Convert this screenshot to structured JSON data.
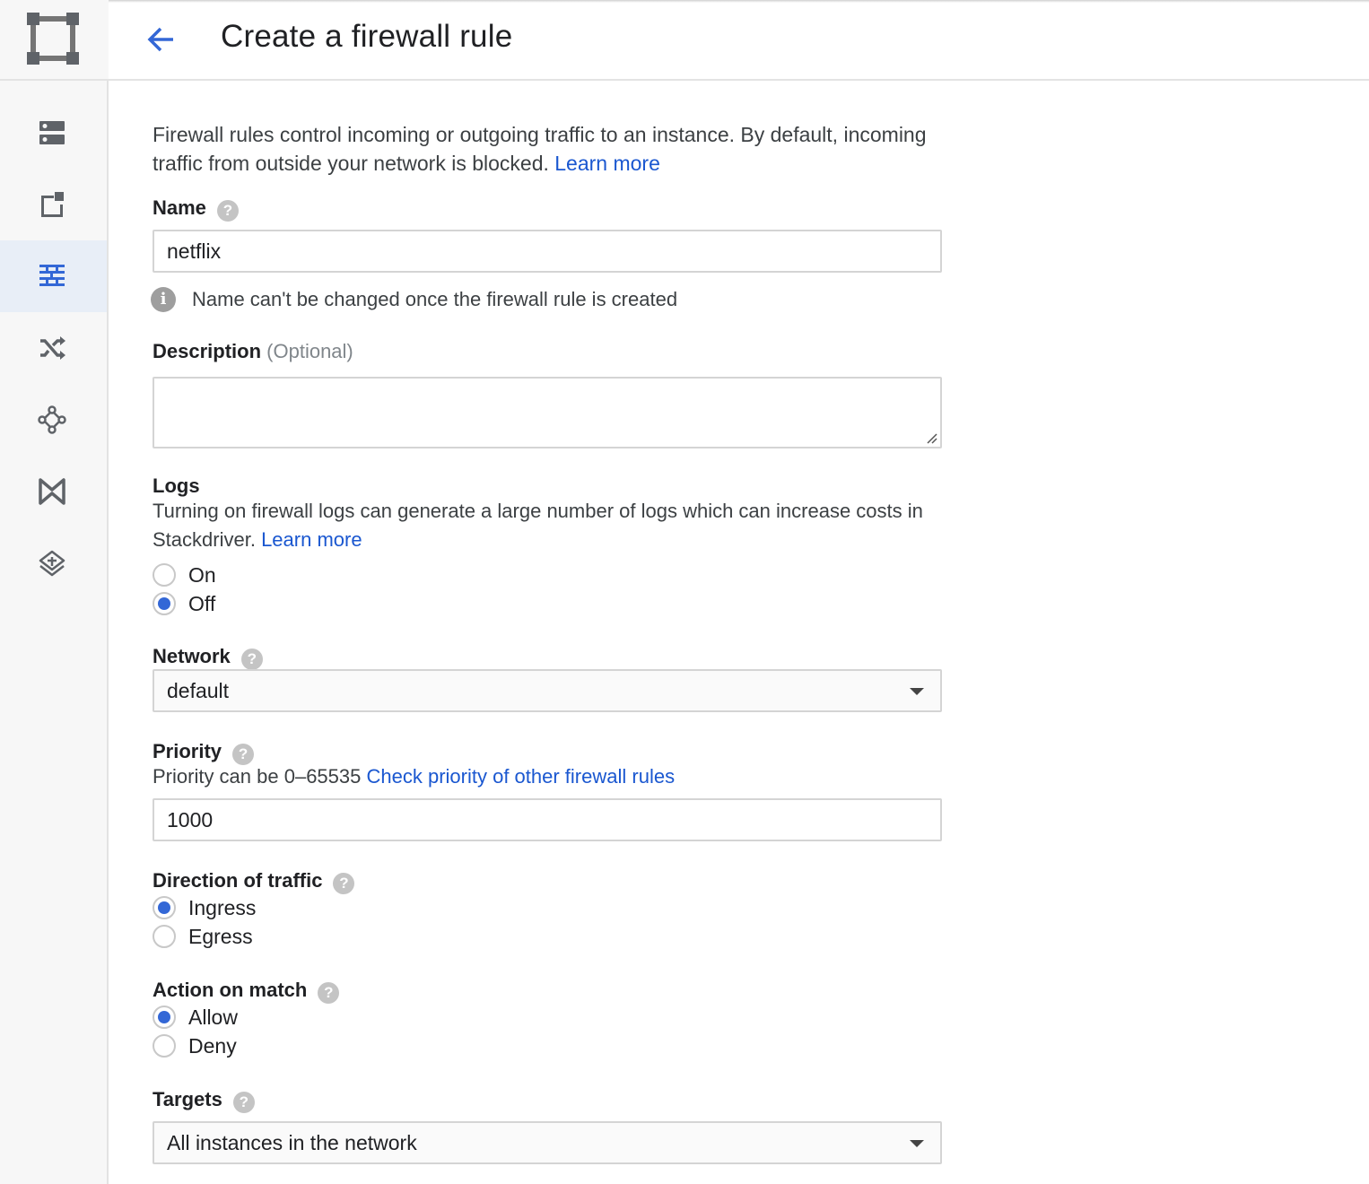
{
  "header": {
    "title": "Create a firewall rule"
  },
  "sidebar": {
    "items": [
      {
        "icon": "instances-icon"
      },
      {
        "icon": "external-ip-icon"
      },
      {
        "icon": "firewall-icon",
        "active": true
      },
      {
        "icon": "routes-icon"
      },
      {
        "icon": "vpc-peering-icon"
      },
      {
        "icon": "shared-vpc-icon"
      },
      {
        "icon": "serverless-vpc-icon"
      }
    ]
  },
  "intro": {
    "text": "Firewall rules control incoming or outgoing traffic to an instance. By default, incoming traffic from outside your network is blocked.",
    "link": "Learn more"
  },
  "name": {
    "label": "Name",
    "value": "netflix",
    "info": "Name can't be changed once the firewall rule is created"
  },
  "description": {
    "label": "Description",
    "optional": "(Optional)",
    "value": ""
  },
  "logs": {
    "label": "Logs",
    "text": "Turning on firewall logs can generate a large number of logs which can increase costs in Stackdriver.",
    "link": "Learn more",
    "options": [
      {
        "label": "On",
        "checked": false
      },
      {
        "label": "Off",
        "checked": true
      }
    ]
  },
  "network": {
    "label": "Network",
    "value": "default"
  },
  "priority": {
    "label": "Priority",
    "hint": "Priority can be 0–65535",
    "link": "Check priority of other firewall rules",
    "value": "1000"
  },
  "direction": {
    "label": "Direction of traffic",
    "options": [
      {
        "label": "Ingress",
        "checked": true
      },
      {
        "label": "Egress",
        "checked": false
      }
    ]
  },
  "action": {
    "label": "Action on match",
    "options": [
      {
        "label": "Allow",
        "checked": true
      },
      {
        "label": "Deny",
        "checked": false
      }
    ]
  },
  "targets": {
    "label": "Targets",
    "value": "All instances in the network"
  },
  "colors": {
    "accent": "#3367d6",
    "link": "#1a57d0",
    "sidebar_active": "#e8eef7"
  }
}
